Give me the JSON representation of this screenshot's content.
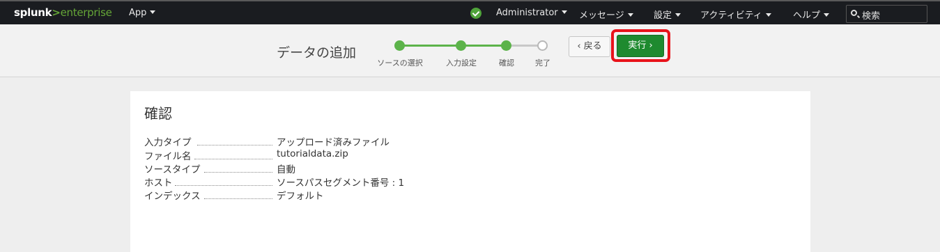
{
  "brand": {
    "name": "splunk",
    "separator": ">",
    "product": "enterprise"
  },
  "topnav": {
    "app_menu": "App",
    "user_menu": "Administrator",
    "messages_menu": "メッセージ",
    "settings_menu": "設定",
    "activity_menu": "アクティビティ",
    "help_menu": "ヘルプ",
    "search_placeholder": "検索"
  },
  "header": {
    "title": "データの追加",
    "steps": [
      {
        "label": "ソースの選択",
        "state": "done"
      },
      {
        "label": "入力設定",
        "state": "done"
      },
      {
        "label": "確認",
        "state": "done"
      },
      {
        "label": "完了",
        "state": "todo"
      }
    ],
    "back_button": "‹ 戻る",
    "submit_button": "実行 ›"
  },
  "review": {
    "title": "確認",
    "rows": [
      {
        "key": "入力タイプ",
        "value": "アップロード済みファイル"
      },
      {
        "key": "ファイル名",
        "value": "tutorialdata.zip"
      },
      {
        "key": "ソースタイプ",
        "value": "自動"
      },
      {
        "key": "ホスト",
        "value": "ソースパスセグメント番号 : 1"
      },
      {
        "key": "インデックス",
        "value": "デフォルト"
      }
    ]
  },
  "colors": {
    "accent_green": "#5cb34a",
    "button_green": "#1e8a2f",
    "highlight_red": "#e8131b",
    "nav_bg": "#1a1c20"
  }
}
